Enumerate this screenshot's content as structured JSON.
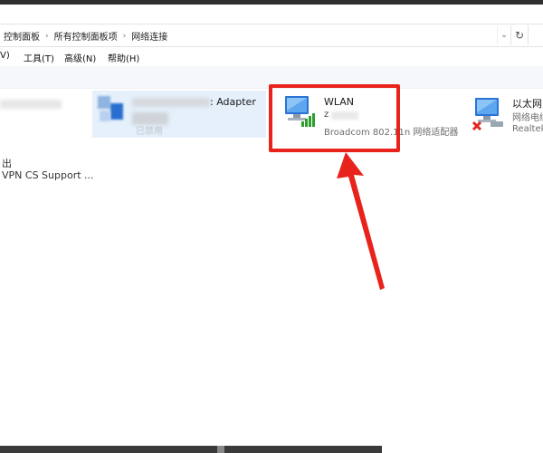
{
  "address_bar": {
    "crumbs": [
      "控制面板",
      "所有控制面板项",
      "网络连接"
    ]
  },
  "menu": {
    "view": "V)",
    "tools": "工具(T)",
    "advanced": "高级(N)",
    "help": "帮助(H)"
  },
  "adapters": {
    "left": {
      "label_fragment": "出",
      "description": "VPN CS Support ..."
    },
    "selected": {
      "name_fragment": ": Adapter",
      "status_fragment": "已禁用"
    },
    "wlan": {
      "name": "WLAN",
      "network_fragment": "z",
      "description": "Broadcom 802.11n 网络适配器"
    },
    "ethernet": {
      "name": "以太网",
      "status": "网络电缆",
      "description": "Realtek"
    }
  },
  "colors": {
    "highlight": "#e8231c",
    "selection": "#e5f0fb"
  }
}
